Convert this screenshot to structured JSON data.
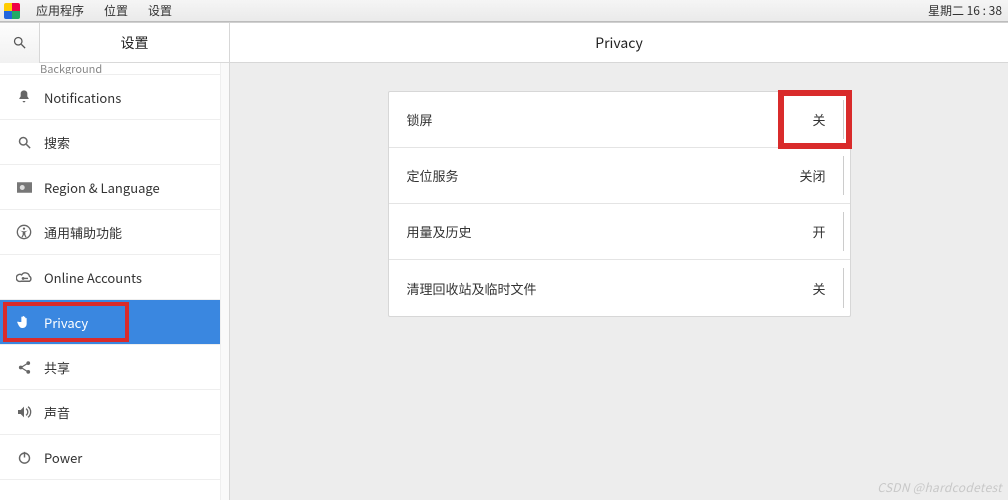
{
  "menubar": {
    "apps": "应用程序",
    "places": "位置",
    "settings": "设置",
    "clock": "星期二 16 : 38"
  },
  "sidebar": {
    "title": "设置",
    "cut_label": "Background",
    "items": {
      "notifications": "Notifications",
      "search": "搜索",
      "region": "Region & Language",
      "accessibility": "通用辅助功能",
      "online": "Online Accounts",
      "privacy": "Privacy",
      "share": "共享",
      "sound": "声音",
      "power": "Power"
    }
  },
  "right": {
    "title": "Privacy",
    "rows": {
      "lock": {
        "label": "锁屏",
        "value": "关"
      },
      "location": {
        "label": "定位服务",
        "value": "关闭"
      },
      "usage": {
        "label": "用量及历史",
        "value": "开"
      },
      "trash": {
        "label": "清理回收站及临时文件",
        "value": "关"
      }
    }
  },
  "watermark": "CSDN @hardcodetest"
}
